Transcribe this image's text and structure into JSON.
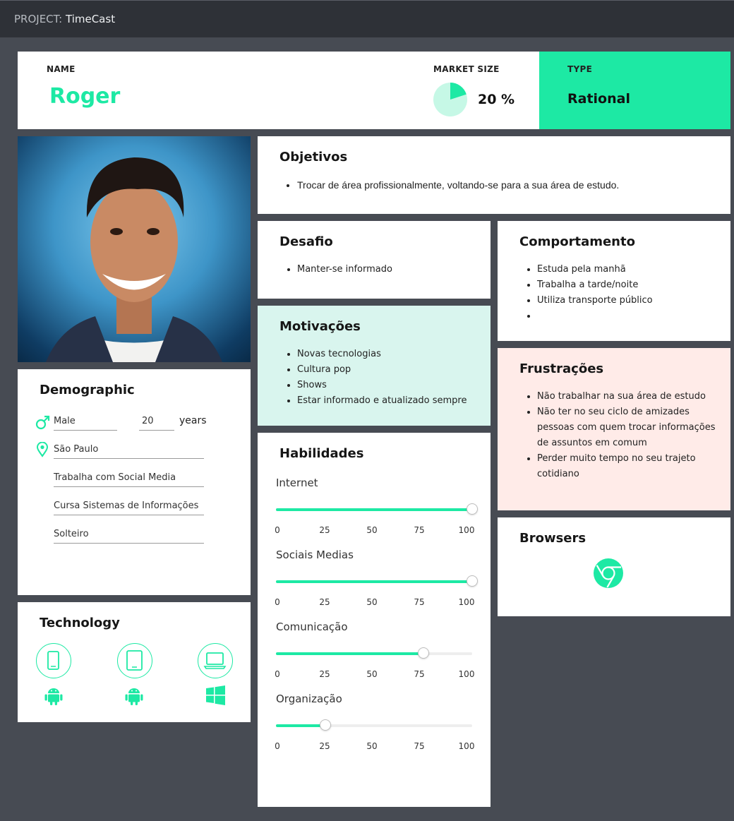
{
  "header": {
    "project_label": "PROJECT:",
    "project_name": "TimeCast"
  },
  "persona": {
    "name_label": "NAME",
    "name": "Roger",
    "market_label": "MARKET SIZE",
    "market_value": "20 %",
    "market_fraction": 0.2,
    "type_label": "TYPE",
    "type_value": "Rational"
  },
  "objetivos": {
    "title": "Objetivos",
    "items": [
      "Trocar de área profissionalmente, voltando-se para a sua área de estudo."
    ]
  },
  "desafio": {
    "title": "Desafio",
    "items": [
      "Manter-se informado"
    ]
  },
  "comportamento": {
    "title": "Comportamento",
    "items": [
      "Estuda pela manhã",
      "Trabalha a tarde/noite",
      "Utiliza transporte público",
      ""
    ]
  },
  "motivacoes": {
    "title": "Motivações",
    "items": [
      "Novas tecnologias",
      "Cultura pop",
      "Shows",
      "Estar informado e atualizado sempre"
    ]
  },
  "frustracoes": {
    "title": "Frustrações",
    "items": [
      "Não trabalhar na sua área de estudo",
      "Não ter no seu ciclo de amizades pessoas com quem trocar informações de assuntos em comum",
      "Perder muito tempo no seu trajeto cotidiano"
    ]
  },
  "demographic": {
    "title": "Demographic",
    "gender": "Male",
    "age": "20",
    "age_unit": "years",
    "location": "São Paulo",
    "job": "Trabalha com Social Media",
    "study": "Cursa Sistemas de Informações",
    "status": "Solteiro"
  },
  "technology": {
    "title": "Technology",
    "devices": [
      {
        "device_icon": "smartphone-icon",
        "os_icon": "android-icon"
      },
      {
        "device_icon": "tablet-icon",
        "os_icon": "android-icon"
      },
      {
        "device_icon": "laptop-icon",
        "os_icon": "windows-icon"
      }
    ]
  },
  "habilidades": {
    "title": "Habilidades",
    "ticks": [
      "0",
      "25",
      "50",
      "75",
      "100"
    ],
    "skills": [
      {
        "name": "Internet",
        "value": 100
      },
      {
        "name": "Sociais Medias",
        "value": 100
      },
      {
        "name": "Comunicação",
        "value": 75
      },
      {
        "name": "Organização",
        "value": 25
      }
    ]
  },
  "browsers": {
    "title": "Browsers",
    "icons": [
      "chrome-icon"
    ]
  },
  "colors": {
    "accent": "#1de9a4",
    "motiv_bg": "#d9f5ee",
    "frustr_bg": "#ffebe8",
    "page_bg": "#474b53",
    "topbar_bg": "#2e3137"
  }
}
